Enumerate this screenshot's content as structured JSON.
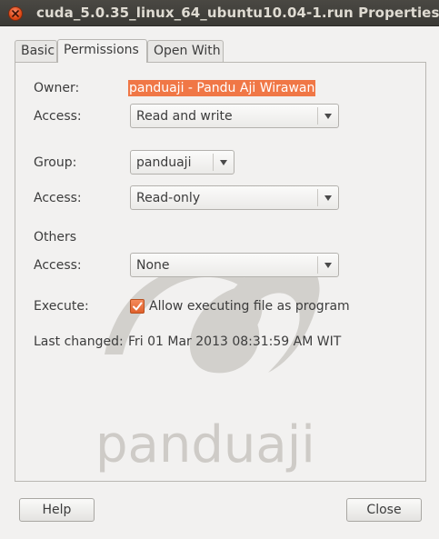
{
  "window": {
    "title": "cuda_5.0.35_linux_64_ubuntu10.04-1.run Properties"
  },
  "tabs": [
    {
      "label": "Basic",
      "active": false
    },
    {
      "label": "Permissions",
      "active": true
    },
    {
      "label": "Open With",
      "active": false
    }
  ],
  "permissions": {
    "owner_label": "Owner:",
    "owner_value": "panduaji - Pandu Aji Wirawan",
    "owner_access_label": "Access:",
    "owner_access_value": "Read and write",
    "group_label": "Group:",
    "group_value": "panduaji",
    "group_access_label": "Access:",
    "group_access_value": "Read-only",
    "others_heading": "Others",
    "others_access_label": "Access:",
    "others_access_value": "None",
    "execute_label": "Execute:",
    "execute_checkbox_label": "Allow executing file as program",
    "execute_checked": true,
    "last_changed_label": "Last changed:",
    "last_changed_value": "Fri 01 Mar 2013 08:31:59 AM WIT"
  },
  "watermark": {
    "text": "panduaji"
  },
  "buttons": {
    "help": "Help",
    "close": "Close"
  },
  "colors": {
    "accent": "#f07746",
    "titlebar": "#3c3b37",
    "close_button": "#df4a16"
  },
  "icons": [
    "close-icon",
    "dropdown-arrow-icon",
    "checkmark-icon"
  ]
}
